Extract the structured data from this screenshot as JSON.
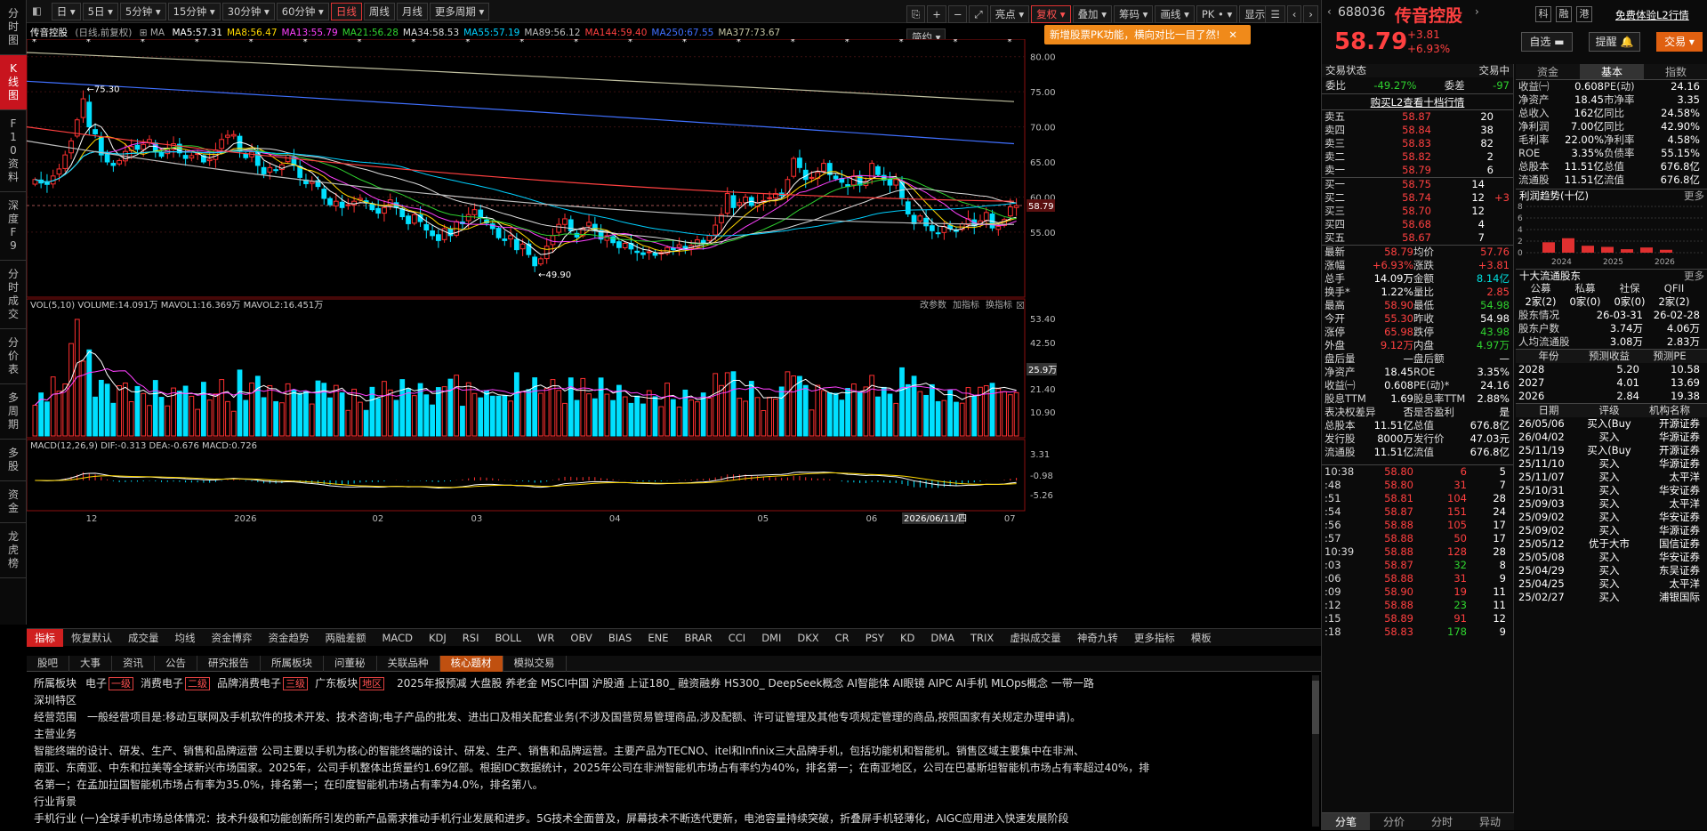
{
  "sidebar": [
    {
      "l": "分时图"
    },
    {
      "l": "K线图",
      "act": true
    },
    {
      "l": "F10资料"
    },
    {
      "l": "深度F9"
    },
    {
      "l": "分时成交"
    },
    {
      "l": "分价表"
    },
    {
      "l": "多周期"
    },
    {
      "l": "多股"
    },
    {
      "l": "资金"
    },
    {
      "l": "龙虎榜"
    }
  ],
  "toolbar": {
    "periods": [
      "日",
      "5日",
      "5分钟",
      "15分钟",
      "30分钟",
      "60分钟",
      "日线",
      "周线",
      "月线",
      "更多周期"
    ],
    "active": "日线",
    "tools": [
      "亮点",
      "复权",
      "叠加",
      "筹码",
      "画线",
      "PK",
      "显示",
      "简约"
    ]
  },
  "notice": "新增股票PK功能，横向对比一目了然!",
  "malegend": {
    "name": "传音控股",
    "sub": "(日线,前复权)",
    "items": [
      {
        "t": "MA5:57.31",
        "c": "#ffffff"
      },
      {
        "t": "MA8:56.47",
        "c": "#ffd800"
      },
      {
        "t": "MA13:55.79",
        "c": "#ff40ff"
      },
      {
        "t": "MA21:56.28",
        "c": "#2fd32f"
      },
      {
        "t": "MA34:58.53",
        "c": "#dddddd"
      },
      {
        "t": "MA55:57.19",
        "c": "#00d0ff"
      },
      {
        "t": "MA89:56.12",
        "c": "#bbbbbb"
      },
      {
        "t": "MA144:59.40",
        "c": "#ff4040"
      },
      {
        "t": "MA250:67.55",
        "c": "#4070ff"
      },
      {
        "t": "MA377:73.67",
        "c": "#c0c0a0"
      }
    ]
  },
  "chart_data": {
    "type": "candlestick",
    "price_axis": [
      "80.00",
      "75.00",
      "70.00",
      "65.00",
      "60.00",
      "55.00"
    ],
    "current": "58.79",
    "high_mark": "75.30",
    "low_mark": "49.90",
    "vol_axis": [
      "53.40",
      "42.50",
      "31.70",
      "21.40",
      "10.90"
    ],
    "vol_current": "25.9万",
    "macd_axis": [
      "3.31",
      "-0.98",
      "-5.26"
    ],
    "time_labels": [
      "12",
      "2026",
      "02",
      "03",
      "04",
      "05",
      "06",
      "07"
    ],
    "date_marker": "2026/06/11/四",
    "closes": [
      62.5,
      62,
      61.8,
      63,
      64,
      66,
      68,
      71,
      74,
      70,
      69,
      66,
      65,
      64.5,
      65.2,
      66.5,
      67.2,
      66.8,
      67.5,
      68.2,
      66.5,
      65.8,
      66.8,
      67.6,
      66.3,
      65.5,
      65.9,
      66.2,
      65,
      65.4,
      66.7,
      68.2,
      68.8,
      68.9,
      66.5,
      65.6,
      66.4,
      64.5,
      63.3,
      64.2,
      63.8,
      64.6,
      66,
      64.5,
      62.8,
      61.9,
      62.2,
      61.5,
      59.8,
      58.9,
      59.4,
      58.5,
      58.9,
      59.4,
      59.8,
      59.2,
      58.2,
      57.7,
      58.5,
      59.6,
      58.5,
      57.2,
      56.2,
      57.5,
      56.5,
      55.3,
      54.5,
      53.8,
      55.5,
      54.5,
      56.5,
      56.2,
      57.5,
      58.2,
      57.1,
      56.3,
      55.5,
      54.2,
      53.8,
      54.5,
      52.5,
      53.3,
      51.8,
      50.2,
      51.2,
      53,
      54.5,
      56.1,
      56.9,
      55.2,
      54.3,
      55.5,
      56.4,
      55.3,
      54,
      54.5,
      53.5,
      52.8,
      53.4,
      52.6,
      52.1,
      51.8,
      52.2,
      51.7,
      52.1,
      52.8,
      52.5,
      53.2,
      52.5,
      53.1,
      53.9,
      53.4,
      54.5,
      56,
      57.5,
      60.5,
      58.5,
      59.2,
      60,
      58.8,
      59.2,
      59.5,
      59.9,
      60.5,
      60.2,
      62.5,
      65.5,
      64.2,
      62.5,
      62.8,
      63.5,
      64.8,
      63.2,
      62.6,
      62.1,
      61.5,
      63,
      61.7,
      62.2,
      64.8,
      63.2,
      62.4,
      61.7,
      62.5,
      59.9,
      57.6,
      56.2,
      57.3,
      55.9,
      55.2,
      54.8,
      55.8,
      55.5,
      55.1,
      56.2,
      56.9,
      55.9,
      56.6,
      57.8,
      55.6,
      55.8,
      56.8,
      58.6,
      58.79
    ]
  },
  "volume_legend": [
    {
      "t": "VOL(5,10)",
      "c": "#cccccc"
    },
    {
      "t": "VOLUME:14.091万",
      "c": "#ffffff"
    },
    {
      "t": "MAVOL1:16.369万",
      "c": "#ffffff"
    },
    {
      "t": "MAVOL2:16.451万",
      "c": "#ff40ff"
    }
  ],
  "macd_legend": [
    {
      "t": "MACD(12,26,9)",
      "c": "#cccccc"
    },
    {
      "t": "DIF:-0.313",
      "c": "#ffffff"
    },
    {
      "t": "DEA:-0.676",
      "c": "#ffd800"
    },
    {
      "t": "MACD:0.726",
      "c": "#ff40ff"
    }
  ],
  "pane_tools": [
    "改参数",
    "加指标",
    "换指标"
  ],
  "indicators": [
    "指标",
    "恢复默认",
    "成交量",
    "均线",
    "资金博弈",
    "资金趋势",
    "两融差额",
    "MACD",
    "KDJ",
    "RSI",
    "BOLL",
    "WR",
    "OBV",
    "BIAS",
    "ENE",
    "BRAR",
    "CCI",
    "DMI",
    "DKX",
    "CR",
    "PSY",
    "KD",
    "DMA",
    "TRIX",
    "虚拟成交量",
    "神奇九转",
    "更多指标",
    "模板"
  ],
  "bottom_tabs": [
    "股吧",
    "大事",
    "资讯",
    "公告",
    "研究报告",
    "所属板块",
    "问董秘",
    "关联品种",
    "核心题材",
    "模拟交易"
  ],
  "bottom_active": "核心题材",
  "core": {
    "l1": "所属板块",
    "sectors": [
      {
        "t": "电子",
        "b": "一级"
      },
      {
        "t": "消费电子",
        "b": "二级"
      },
      {
        "t": "品牌消费电子",
        "b": "三级"
      },
      {
        "t": "广东板块",
        "b": "地区"
      }
    ],
    "concepts": "2025年报预减  大盘股  养老金  MSCI中国  沪股通  上证180_  融资融券  HS300_  DeepSeek概念  AI智能体  AI眼镜  AIPC  AI手机  MLOps概念  一带一路",
    "l2": "深圳特区",
    "scope_label": "经营范围",
    "scope": "一般经营项目是:移动互联网及手机软件的技术开发、技术咨询;电子产品的批发、进出口及相关配套业务(不涉及国营贸易管理商品,涉及配额、许可证管理及其他专项规定管理的商品,按照国家有关规定办理申请)。",
    "main_label": "主营业务",
    "main": "智能终端的设计、研发、生产、销售和品牌运营   公司主要以手机为核心的智能终端的设计、研发、生产、销售和品牌运营。主要产品为TECNO、itel和Infinix三大品牌手机，包括功能机和智能机。销售区域主要集中在非洲、",
    "main2": "南亚、东南亚、中东和拉美等全球新兴市场国家。2025年，公司手机整体出货量约1.69亿部。根据IDC数据统计，2025年公司在非洲智能机市场占有率约为40%，排名第一；在南亚地区，公司在巴基斯坦智能机市场占有率超过40%，排",
    "main3": "名第一；在孟加拉国智能机市场占有率为35.0%，排名第一；在印度智能机市场占有率为4.0%，排名第八。",
    "bg_label": "行业背景",
    "bg": "手机行业   (一)全球手机市场总体情况：技术升级和功能创新所引发的新产品需求推动手机行业发展和进步。5G技术全面普及，屏幕技术不断迭代更新，电池容量持续突破，折叠屏手机轻薄化，AIGC应用进入快速发展阶段"
  },
  "stock": {
    "code": "688036",
    "name": "传音控股",
    "price": "58.79",
    "chg": "+3.81",
    "pct": "+6.93%",
    "free": "免费体验L2行情",
    "btns": [
      "自选",
      "提醒",
      "交易"
    ],
    "tags": [
      "科",
      "融",
      "港"
    ]
  },
  "status": {
    "label": "交易状态",
    "val": "交易中",
    "wb": "委比",
    "wbv": "-49.27%",
    "wc": "委差",
    "wcv": "-97",
    "l2": "购买L2查看十档行情"
  },
  "asks": [
    {
      "n": "卖五",
      "p": "58.87",
      "v": "20"
    },
    {
      "n": "卖四",
      "p": "58.84",
      "v": "38"
    },
    {
      "n": "卖三",
      "p": "58.83",
      "v": "82"
    },
    {
      "n": "卖二",
      "p": "58.82",
      "v": "2"
    },
    {
      "n": "卖一",
      "p": "58.79",
      "v": "6"
    }
  ],
  "bids": [
    {
      "n": "买一",
      "p": "58.75",
      "v": "14",
      "x": ""
    },
    {
      "n": "买二",
      "p": "58.74",
      "v": "12",
      "x": "+3"
    },
    {
      "n": "买三",
      "p": "58.70",
      "v": "12",
      "x": ""
    },
    {
      "n": "买四",
      "p": "58.68",
      "v": "4",
      "x": ""
    },
    {
      "n": "买五",
      "p": "58.67",
      "v": "7",
      "x": ""
    }
  ],
  "quote": [
    [
      "最新",
      "58.79",
      "red",
      "均价",
      "57.76",
      "red"
    ],
    [
      "涨幅",
      "+6.93%",
      "red",
      "涨跌",
      "+3.81",
      "red"
    ],
    [
      "总手",
      "14.09万",
      "wht",
      "金额",
      "8.14亿",
      "cyn"
    ],
    [
      "换手*",
      "1.22%",
      "wht",
      "量比",
      "2.85",
      "red"
    ],
    [
      "最高",
      "58.90",
      "red",
      "最低",
      "54.98",
      "grn"
    ],
    [
      "今开",
      "55.30",
      "red",
      "昨收",
      "54.98",
      "wht"
    ],
    [
      "涨停",
      "65.98",
      "red",
      "跌停",
      "43.98",
      "grn"
    ],
    [
      "外盘",
      "9.12万",
      "red",
      "内盘",
      "4.97万",
      "grn"
    ],
    [
      "盘后量",
      "—",
      "wht",
      "盘后额",
      "—",
      "wht"
    ],
    [
      "净资产",
      "18.45",
      "wht",
      "ROE",
      "3.35%",
      "wht"
    ],
    [
      "收益㈠",
      "0.608",
      "wht",
      "PE(动)*",
      "24.16",
      "wht"
    ],
    [
      "股息TTM",
      "1.69",
      "wht",
      "股息率TTM",
      "2.88%",
      "wht"
    ],
    [
      "表决权差异",
      "否",
      "wht",
      "是否盈利",
      "是",
      "wht"
    ],
    [
      "总股本",
      "11.51亿",
      "wht",
      "总值",
      "676.8亿",
      "wht"
    ],
    [
      "发行股",
      "8000万",
      "wht",
      "发行价",
      "47.03元",
      "wht"
    ],
    [
      "流通股",
      "11.51亿",
      "wht",
      "流值",
      "676.8亿",
      "wht"
    ]
  ],
  "ticks": [
    [
      "10:38",
      "58.80",
      "6",
      "5",
      "red"
    ],
    [
      ":48",
      "58.80",
      "31",
      "7",
      "red"
    ],
    [
      ":51",
      "58.81",
      "104",
      "28",
      "red"
    ],
    [
      ":54",
      "58.87",
      "151",
      "24",
      "red"
    ],
    [
      ":56",
      "58.88",
      "105",
      "17",
      "red"
    ],
    [
      ":57",
      "58.88",
      "50",
      "17",
      "red"
    ],
    [
      "10:39",
      "58.88",
      "128",
      "28",
      "red"
    ],
    [
      ":03",
      "58.87",
      "32",
      "8",
      "grn"
    ],
    [
      ":06",
      "58.88",
      "31",
      "9",
      "red"
    ],
    [
      ":09",
      "58.90",
      "19",
      "11",
      "red"
    ],
    [
      ":12",
      "58.88",
      "23",
      "11",
      "grn"
    ],
    [
      ":15",
      "58.89",
      "91",
      "12",
      "red"
    ],
    [
      ":18",
      "58.83",
      "178",
      "9",
      "grn"
    ]
  ],
  "tick_tabs": [
    "分笔",
    "分价",
    "分时",
    "异动"
  ],
  "fin_tabs": [
    "资金",
    "基本",
    "指数"
  ],
  "fin": [
    [
      "收益㈠",
      "0.608",
      "PE(动)",
      "24.16"
    ],
    [
      "净资产",
      "18.45",
      "市净率",
      "3.35"
    ],
    [
      "总收入",
      "162亿",
      "同比",
      "24.58%"
    ],
    [
      "净利润",
      "7.00亿",
      "同比",
      "42.90%"
    ],
    [
      "毛利率",
      "22.00%",
      "净利率",
      "4.58%"
    ],
    [
      "ROE",
      "3.35%",
      "负债率",
      "55.15%"
    ],
    [
      "总股本",
      "11.51亿",
      "总值",
      "676.8亿"
    ],
    [
      "流通股",
      "11.51亿",
      "流值",
      "676.8亿"
    ]
  ],
  "profit_title": "利润趋势(十亿)",
  "profit_more": "更多",
  "profit": {
    "ticks": [
      "8",
      "6",
      "4",
      "2",
      "0"
    ],
    "years": [
      "2024",
      "2025",
      "2026"
    ],
    "bars": [
      1.8,
      2.5,
      1.2,
      1.0,
      0.6,
      0.9,
      0.5
    ]
  },
  "holders": {
    "title": "十大流通股东",
    "more": "更多",
    "cols": [
      "公募",
      "私募",
      "社保",
      "QFII"
    ],
    "vals": [
      "2家(2)",
      "0家(0)",
      "0家(0)",
      "2家(2)"
    ],
    "rows": [
      [
        "股东情况",
        "26-03-31",
        "26-02-28"
      ],
      [
        "股东户数",
        "3.74万",
        "4.06万"
      ],
      [
        "人均流通股",
        "3.08万",
        "2.83万"
      ]
    ]
  },
  "forecast": {
    "cols": [
      "年份",
      "预测收益",
      "预测PE"
    ],
    "rows": [
      [
        "2028",
        "5.20",
        "10.58"
      ],
      [
        "2027",
        "4.01",
        "13.69"
      ],
      [
        "2026",
        "2.84",
        "19.38"
      ]
    ]
  },
  "ratings": {
    "cols": [
      "日期",
      "评级",
      "机构名称"
    ],
    "rows": [
      [
        "26/05/06",
        "买入(Buy",
        "开源证券"
      ],
      [
        "26/04/02",
        "买入",
        "华源证券"
      ],
      [
        "25/11/19",
        "买入(Buy",
        "开源证券"
      ],
      [
        "25/11/10",
        "买入",
        "华源证券"
      ],
      [
        "25/11/07",
        "买入",
        "太平洋"
      ],
      [
        "25/10/31",
        "买入",
        "华安证券"
      ],
      [
        "25/09/03",
        "买入",
        "太平洋"
      ],
      [
        "25/09/02",
        "买入",
        "华安证券"
      ],
      [
        "25/09/02",
        "买入",
        "华源证券"
      ],
      [
        "25/05/12",
        "优于大市",
        "国信证券"
      ],
      [
        "25/05/08",
        "买入",
        "华安证券"
      ],
      [
        "25/04/29",
        "买入",
        "东吴证券"
      ],
      [
        "25/04/25",
        "买入",
        "太平洋"
      ],
      [
        "25/02/27",
        "买入",
        "浦银国际"
      ]
    ]
  }
}
